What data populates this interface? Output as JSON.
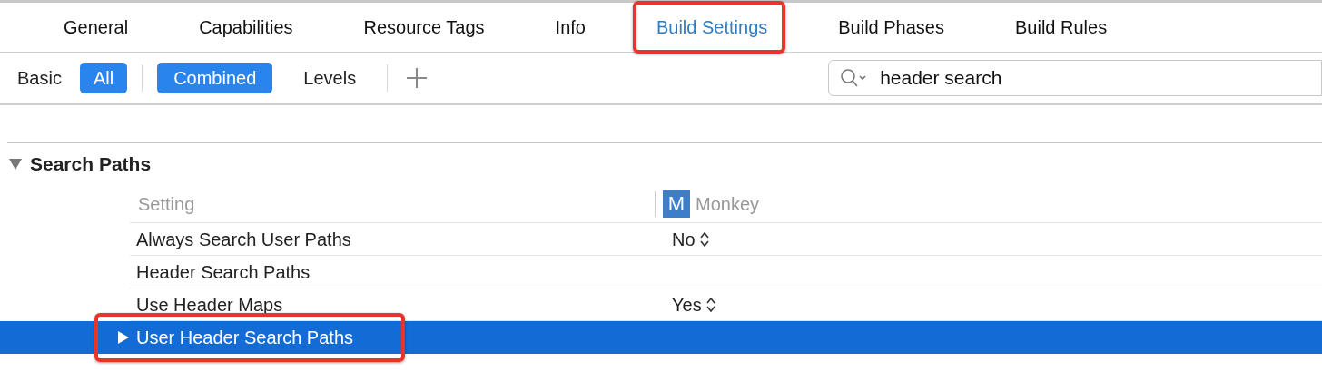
{
  "tabs": [
    {
      "label": "General",
      "selected": false,
      "annotated": false
    },
    {
      "label": "Capabilities",
      "selected": false,
      "annotated": false
    },
    {
      "label": "Resource Tags",
      "selected": false,
      "annotated": false
    },
    {
      "label": "Info",
      "selected": false,
      "annotated": false
    },
    {
      "label": "Build Settings",
      "selected": true,
      "annotated": true
    },
    {
      "label": "Build Phases",
      "selected": false,
      "annotated": false
    },
    {
      "label": "Build Rules",
      "selected": false,
      "annotated": false
    }
  ],
  "filters": [
    {
      "label": "Basic",
      "selected": false
    },
    {
      "label": "All",
      "selected": true
    }
  ],
  "views": [
    {
      "label": "Combined",
      "selected": true
    },
    {
      "label": "Levels",
      "selected": false
    }
  ],
  "search": {
    "value": "header search"
  },
  "section": {
    "title": "Search Paths",
    "expanded": true,
    "columns": {
      "setting": "Setting",
      "target_icon": "M",
      "target": "Monkey"
    },
    "rows": [
      {
        "name": "Always Search User Paths",
        "value": "No",
        "selected": false,
        "expandable": false,
        "annotated": false
      },
      {
        "name": "Header Search Paths",
        "selected": false,
        "expandable": false,
        "annotated": false
      },
      {
        "name": "Use Header Maps",
        "value": "Yes",
        "selected": false,
        "expandable": false,
        "annotated": false
      },
      {
        "name": "User Header Search Paths",
        "selected": true,
        "expandable": true,
        "annotated": true
      }
    ]
  }
}
